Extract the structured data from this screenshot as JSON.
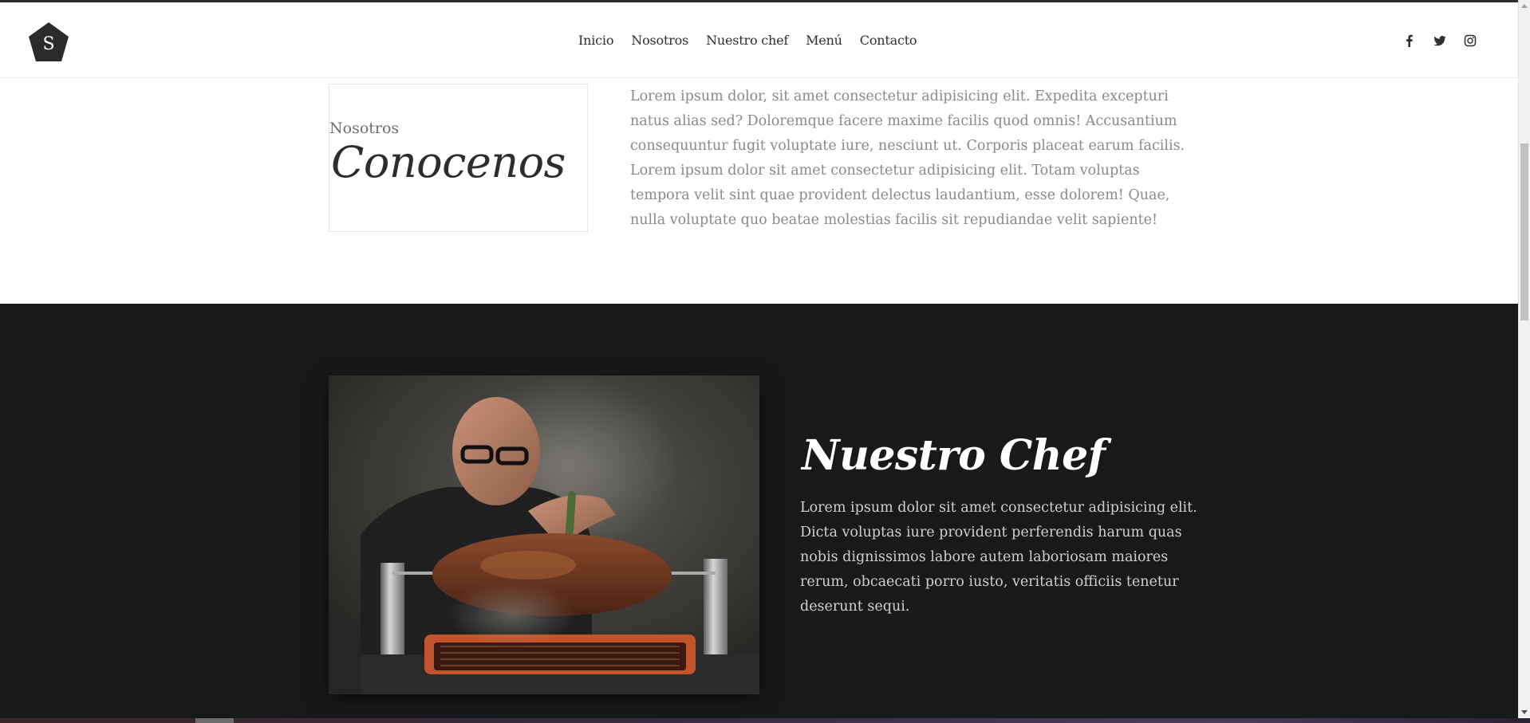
{
  "header": {
    "logo_letter": "S",
    "nav": [
      "Inicio",
      "Nosotros",
      "Nuestro chef",
      "Menú",
      "Contacto"
    ],
    "social_icons": [
      "facebook-icon",
      "twitter-icon",
      "instagram-icon"
    ]
  },
  "about": {
    "subtitle": "Nosotros",
    "title": "Conocenos",
    "text": "Lorem ipsum dolor, sit amet consectetur adipisicing elit. Expedita excepturi natus alias sed? Doloremque facere maxime facilis quod omnis! Accusantium consequuntur fugit voluptate iure, nesciunt ut. Corporis placeat earum facilis. Lorem ipsum dolor sit amet consectetur adipisicing elit. Totam voluptas tempora velit sint quae provident delectus laudantium, esse dolorem! Quae, nulla voluptate quo beatae molestias facilis sit repudiandae velit sapiente!"
  },
  "chef": {
    "title": "Nuestro Chef",
    "text": "Lorem ipsum dolor sit amet consectetur adipisicing elit. Dicta voluptas iure provident perferendis harum quas nobis dignissimos labore autem laboriosam maiores rerum, obcaecati porro iusto, veritatis officiis tenetur deserunt sequi."
  },
  "colors": {
    "dark_section": "#18191b",
    "text_dark": "#2d2d2d",
    "text_muted": "#8a8a8a"
  }
}
